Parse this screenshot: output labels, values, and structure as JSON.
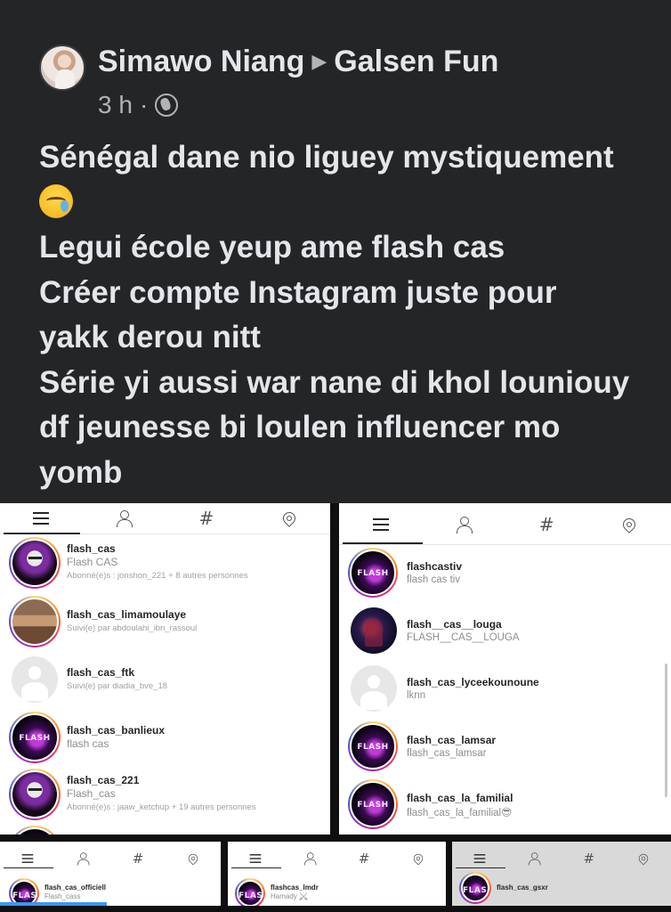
{
  "post": {
    "author": "Simawo Niang",
    "group": "Galsen Fun",
    "time": "3 h",
    "separator": "·",
    "lines": [
      "Sénégal dane nio liguey mystiquement",
      "Legui école yeup ame flash cas",
      "Créer compte Instagram juste pour",
      "yakk derou nitt",
      "Série yi aussi war nane di khol louniouy",
      "df jeunesse bi loulen influencer mo",
      "yomb"
    ],
    "emoji": "crying-face-emoji"
  },
  "left_panel": {
    "tabs": [
      "menu-icon",
      "user-icon",
      "#",
      "pin-icon"
    ],
    "results": [
      {
        "username": "flash_cas",
        "name": "Flash CAS",
        "note": "Abonné(e)s : jonshon_221 + 8 autres personnes",
        "avatar": "mask"
      },
      {
        "username": "flash_cas_limamoulaye",
        "name": "",
        "note": "Suivi(e) par abdoulahi_ibn_rassoul",
        "avatar": "room"
      },
      {
        "username": "flash_cas_ftk",
        "name": "",
        "note": "Suivi(e) par diadia_bve_18",
        "avatar": "blank"
      },
      {
        "username": "flash_cas_banlieux",
        "name": "flash cas",
        "note": "",
        "avatar": "flash"
      },
      {
        "username": "flash_cas_221",
        "name": "Flash_cas",
        "note": "Abonné(e)s : jaaw_ketchup + 19 autres personnes",
        "avatar": "mask"
      }
    ]
  },
  "right_panel": {
    "tabs": [
      "menu-icon",
      "user-icon",
      "#",
      "pin-icon"
    ],
    "results": [
      {
        "username": "flashcastiv",
        "name": "flash cas tiv",
        "avatar": "flash"
      },
      {
        "username": "flash__cas__louga",
        "name": "FLASH__CAS__LOUGA",
        "avatar": "dark"
      },
      {
        "username": "flash_cas_lyceekounoune",
        "name": "lknn",
        "avatar": "blank"
      },
      {
        "username": "flash_cas_lamsar",
        "name": "flash_cas_lamsar",
        "avatar": "flash"
      },
      {
        "username": "flash_cas_la_familial",
        "name": "flash_cas_la_familial😎",
        "avatar": "flash"
      }
    ]
  },
  "bottom_panels": [
    {
      "username": "flash_cas_officiell",
      "name": "Flash_cass",
      "tabs": [
        "menu-icon",
        "user-icon",
        "#",
        "pin-icon"
      ]
    },
    {
      "username": "flashcas_lmdr",
      "name": "Hamady ⚔️",
      "tabs": [
        "menu-icon",
        "user-icon",
        "#",
        "pin-icon"
      ]
    },
    {
      "username": "flash_cas_gsxr",
      "name": "",
      "tabs": [
        "menu-icon",
        "user-icon",
        "#",
        "pin-icon"
      ]
    }
  ]
}
